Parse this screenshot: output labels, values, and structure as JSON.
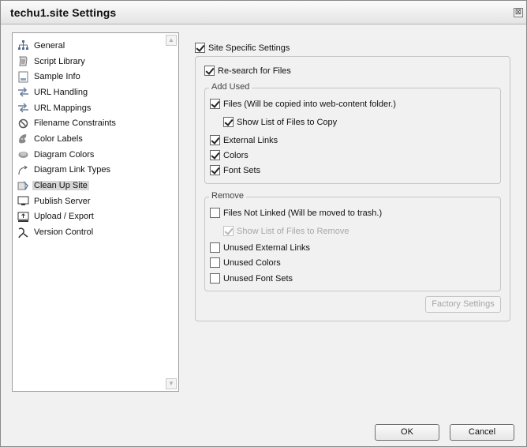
{
  "window": {
    "title": "techu1.site Settings",
    "close_glyph": "⊠"
  },
  "sidebar": {
    "items": [
      {
        "label": "General",
        "icon": "sitemap-icon"
      },
      {
        "label": "Script Library",
        "icon": "script-icon"
      },
      {
        "label": "Sample Info",
        "icon": "document-icon"
      },
      {
        "label": "URL Handling",
        "icon": "arrows-icon"
      },
      {
        "label": "URL Mappings",
        "icon": "arrows-icon"
      },
      {
        "label": "Filename Constraints",
        "icon": "no-entry-icon"
      },
      {
        "label": "Color Labels",
        "icon": "palette-icon"
      },
      {
        "label": "Diagram Colors",
        "icon": "diagram-color-icon"
      },
      {
        "label": "Diagram Link Types",
        "icon": "link-arrow-icon"
      },
      {
        "label": "Clean Up Site",
        "icon": "cleanup-icon",
        "selected": true
      },
      {
        "label": "Publish Server",
        "icon": "monitor-icon"
      },
      {
        "label": "Upload / Export",
        "icon": "upload-monitor-icon"
      },
      {
        "label": "Version Control",
        "icon": "version-icon"
      }
    ],
    "scroll_up": "▲",
    "scroll_down": "▼"
  },
  "main": {
    "site_specific": {
      "label": "Site Specific Settings",
      "checked": true
    },
    "research": {
      "label": "Re-search for Files",
      "checked": true
    },
    "add_used": {
      "legend": "Add Used",
      "files": {
        "label": "Files (Will be copied into web-content folder.)",
        "checked": true
      },
      "show_list": {
        "label": "Show List of Files to Copy",
        "checked": true
      },
      "external_links": {
        "label": "External Links",
        "checked": true
      },
      "colors": {
        "label": "Colors",
        "checked": true
      },
      "font_sets": {
        "label": "Font Sets",
        "checked": true
      }
    },
    "remove": {
      "legend": "Remove",
      "files_not_linked": {
        "label": "Files Not Linked (Will be moved to trash.)",
        "checked": false
      },
      "show_list_remove": {
        "label": "Show List of Files to Remove",
        "checked": true,
        "disabled": true
      },
      "unused_external_links": {
        "label": "Unused External Links",
        "checked": false
      },
      "unused_colors": {
        "label": "Unused Colors",
        "checked": false
      },
      "unused_font_sets": {
        "label": "Unused Font Sets",
        "checked": false
      }
    },
    "factory_settings": "Factory Settings"
  },
  "footer": {
    "ok": "OK",
    "cancel": "Cancel"
  }
}
